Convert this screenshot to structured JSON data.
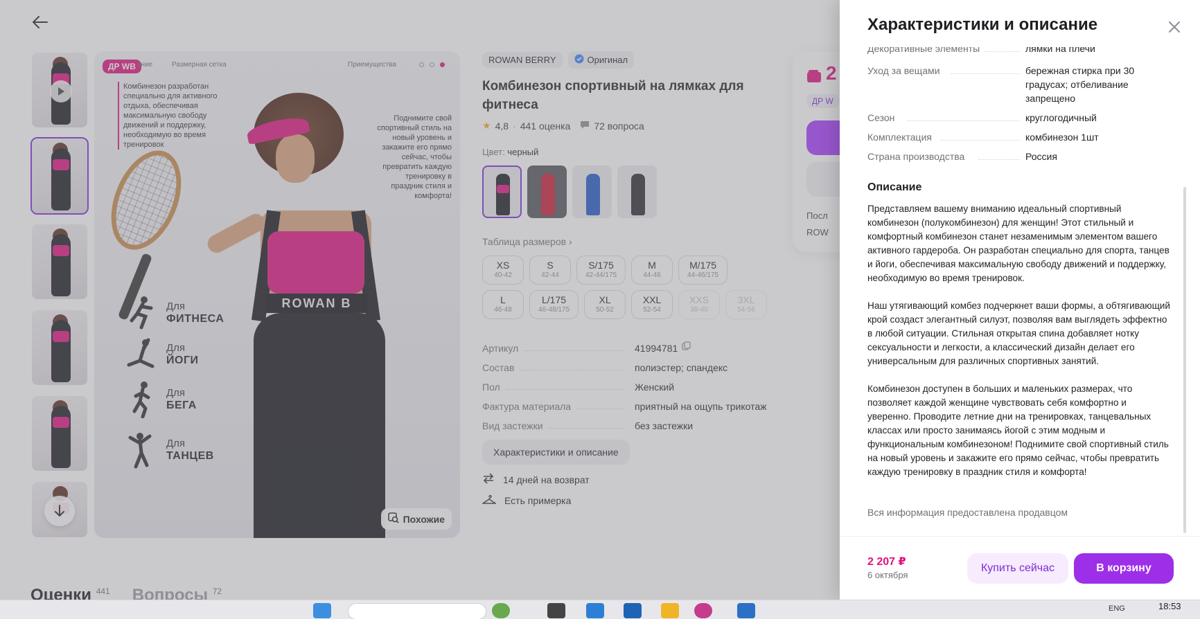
{
  "product": {
    "brand": "ROWAN BERRY",
    "original_label": "Оригинал",
    "title": "Комбинезон спортивный на лямках для фитнеса",
    "rating": "4,8",
    "reviews": "441 оценка",
    "questions": "72 вопроса",
    "color_label": "Цвет:",
    "color_value": "черный",
    "size_table_label": "Таблица размеров",
    "sizes": [
      {
        "size": "XS",
        "ru": "40-42",
        "available": true
      },
      {
        "size": "S",
        "ru": "42-44",
        "available": true
      },
      {
        "size": "S/175",
        "ru": "42-44/175",
        "available": true
      },
      {
        "size": "M",
        "ru": "44-46",
        "available": true
      },
      {
        "size": "M/175",
        "ru": "44-46/175",
        "available": true
      },
      {
        "size": "L",
        "ru": "46-48",
        "available": true
      },
      {
        "size": "L/175",
        "ru": "46-48/175",
        "available": true
      },
      {
        "size": "XL",
        "ru": "50-52",
        "available": true
      },
      {
        "size": "XXL",
        "ru": "52-54",
        "available": true
      },
      {
        "size": "XXS",
        "ru": "38-40",
        "available": false
      },
      {
        "size": "3XL",
        "ru": "54-56",
        "available": false
      }
    ],
    "specs": [
      {
        "k": "Артикул",
        "v": "41994781"
      },
      {
        "k": "Состав",
        "v": "полиэстер; спандекс"
      },
      {
        "k": "Пол",
        "v": "Женский"
      },
      {
        "k": "Фактура материала",
        "v": "приятный на ощупь трикотаж"
      },
      {
        "k": "Вид застежки",
        "v": "без застежки"
      }
    ],
    "char_button": "Характеристики и описание",
    "perks": [
      "14 дней на возврат",
      "Есть примерка"
    ]
  },
  "hero": {
    "badge": "ДР WB",
    "nav": [
      "ание",
      "Размерная сетка",
      "Приемущества"
    ],
    "intro": "Комбинезон разработан специально для активного отдыха, обеспечивая максимальную свободу движений и поддержку, необходимую во время тренировок",
    "promo": "Поднимите свой спортивный стиль на новый уровень и закажите его прямо сейчас, чтобы превратить каждую тренировку в праздник стиля и комфорта!",
    "band_text": "ROWAN B",
    "activities": [
      {
        "a": "Для",
        "b": "ФИТНЕСА"
      },
      {
        "a": "Для",
        "b": "ЙОГИ"
      },
      {
        "a": "Для",
        "b": "БЕГА"
      },
      {
        "a": "Для",
        "b": "ТАНЦЕВ"
      }
    ],
    "similar_button": "Похожие"
  },
  "buy_card": {
    "price_fragment": "2",
    "dr": "ДР W",
    "line1": "Посл",
    "line2": "ROW"
  },
  "bottom_tabs": {
    "reviews": "Оценки",
    "reviews_count": "441",
    "questions": "Вопросы",
    "questions_count": "72"
  },
  "panel": {
    "title": "Характеристики и описание",
    "rows": [
      {
        "k": "Декоративные элементы",
        "v": "лямки на плечи"
      },
      {
        "k": "Уход за вещами",
        "v": "бережная стирка при 30 градусах; отбеливание запрещено"
      },
      {
        "k": "Сезон",
        "v": "круглогодичный"
      },
      {
        "k": "Комплектация",
        "v": "комбинезон 1шт"
      },
      {
        "k": "Страна производства",
        "v": "Россия"
      }
    ],
    "description_heading": "Описание",
    "description": [
      "Представляем вашему вниманию идеальный спортивный комбинезон (полукомбинезон) для женщин! Этот стильный и комфортный комбинезон станет незаменимым элементом вашего активного гардероба. Он разработан специально для спорта, танцев и йоги, обеспечивая максимальную свободу движений и поддержку, необходимую во время тренировок.",
      "Наш утягивающий комбез подчеркнет ваши формы, а обтягивающий крой создаст элегантный силуэт, позволяя вам выглядеть эффектно в любой ситуации. Стильная открытая спина добавляет нотку сексуальности и легкости, а классический дизайн делает его универсальным для различных спортивных занятий.",
      "Комбинезон доступен в больших и маленьких размерах, что позволяет каждой женщине чувствовать себя комфортно и уверенно. Проводите летние дни на тренировках, танцевальных классах или просто занимаясь йогой с этим модным и функциональным комбинезоном! Поднимите свой спортивный стиль на новый уровень и закажите его прямо сейчас, чтобы превратить каждую тренировку в праздник стиля и комфорта!"
    ],
    "seller_note": "Вся информация предоставлена продавцом",
    "footer": {
      "price": "2 207 ₽",
      "date": "6 октября",
      "buy_now": "Купить сейчас",
      "to_cart": "В корзину"
    }
  },
  "taskbar": {
    "lang": "ENG",
    "time": "18:53"
  },
  "colors": {
    "accent": "#9d2fe8",
    "price": "#e0127f",
    "overlay": "#808088"
  }
}
